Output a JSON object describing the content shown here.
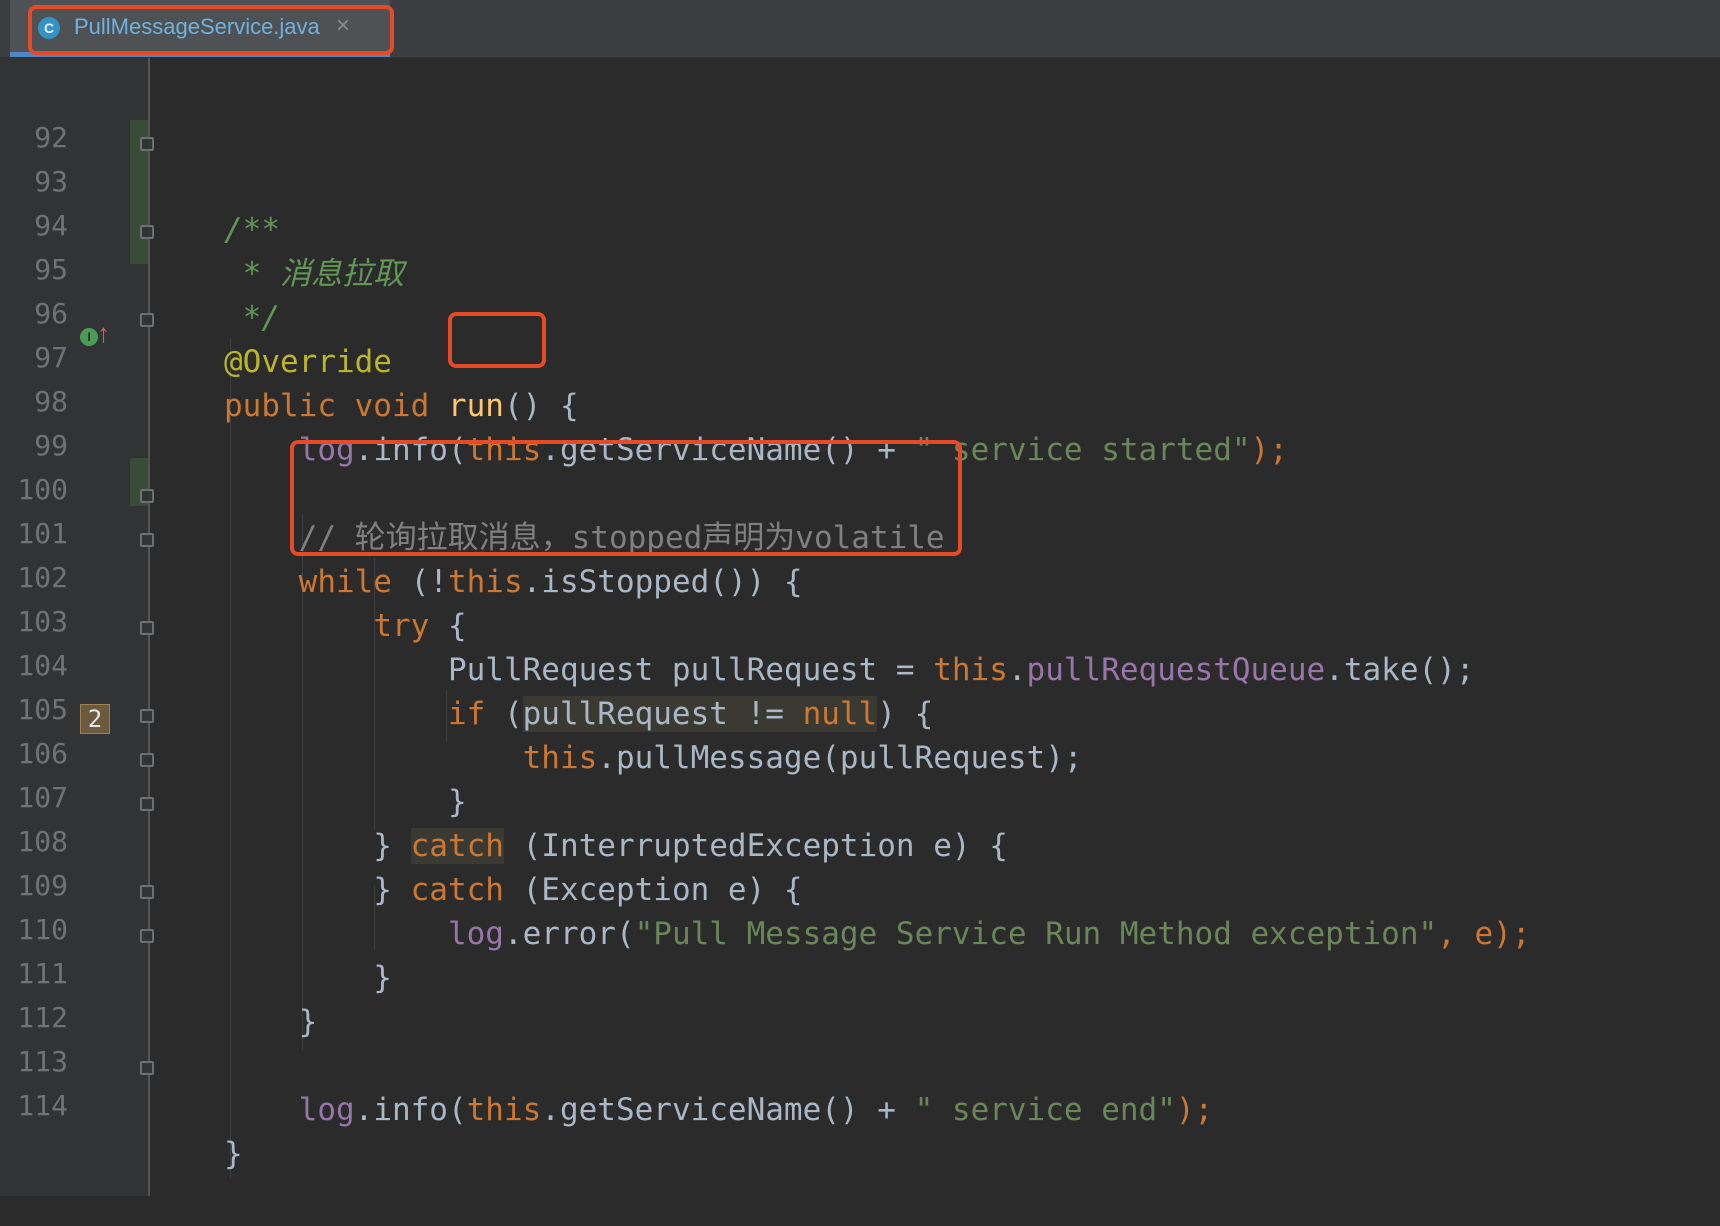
{
  "tab": {
    "icon": "C",
    "title": "PullMessageService.java",
    "close": "×"
  },
  "gutter": {
    "override_icon": "I",
    "override_arrow": "↑",
    "usage_count": "2"
  },
  "lines": [
    {
      "num": "92"
    },
    {
      "num": "93",
      "t1": "/**"
    },
    {
      "num": "94",
      "t1": " * 消息拉取"
    },
    {
      "num": "95",
      "t1": " */"
    },
    {
      "num": "96",
      "t1": "@Override"
    },
    {
      "num": "97",
      "t1": "public void ",
      "t2": "run",
      "t3": "() {"
    },
    {
      "num": "98",
      "t1": "    ",
      "t2": "log",
      "t3": ".info(",
      "t4": "this",
      "t5": ".getServiceName() + ",
      "t6": "\" service started\"",
      "t7": ");"
    },
    {
      "num": "99"
    },
    {
      "num": "100",
      "t1": "    // 轮询拉取消息，stopped声明为volatile"
    },
    {
      "num": "101",
      "t1": "    ",
      "t2": "while",
      "t3": " (!",
      "t4": "this",
      "t5": ".isStopped()) {"
    },
    {
      "num": "102",
      "t1": "        ",
      "t2": "try",
      "t3": " {"
    },
    {
      "num": "103",
      "t1": "            PullRequest pullRequest = ",
      "t2": "this",
      "t3": ".",
      "t4": "pullRequestQueue",
      "t5": ".take();"
    },
    {
      "num": "104",
      "t1": "            ",
      "t2": "if",
      "t3": " (",
      "t4": "pullRequest != ",
      "t5": "null",
      "t6": ") {"
    },
    {
      "num": "105",
      "t1": "                ",
      "t2": "this",
      "t3": ".pullMessage(pullRequest);"
    },
    {
      "num": "106",
      "t1": "            }"
    },
    {
      "num": "107",
      "t1": "        } ",
      "t2": "catch",
      "t3": " (InterruptedException e) {"
    },
    {
      "num": "108",
      "t1": "        } ",
      "t2": "catch",
      "t3": " (Exception e) {"
    },
    {
      "num": "109",
      "t1": "            ",
      "t2": "log",
      "t3": ".error(",
      "t4": "\"Pull Message Service Run Method exception\"",
      "t5": ", e);"
    },
    {
      "num": "110",
      "t1": "        }"
    },
    {
      "num": "111",
      "t1": "    }"
    },
    {
      "num": "112"
    },
    {
      "num": "113",
      "t1": "    ",
      "t2": "log",
      "t3": ".info(",
      "t4": "this",
      "t5": ".getServiceName() + ",
      "t6": "\" service end\"",
      "t7": ");"
    },
    {
      "num": "114",
      "t1": "}"
    }
  ]
}
